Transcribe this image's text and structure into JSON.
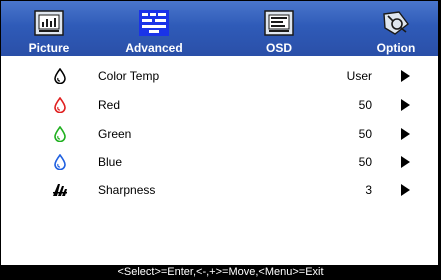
{
  "tabs": [
    {
      "label": "Picture",
      "icon": "picture-icon",
      "active": false
    },
    {
      "label": "Advanced",
      "icon": "advanced-icon",
      "active": true
    },
    {
      "label": "OSD",
      "icon": "osd-icon",
      "active": false
    },
    {
      "label": "Option",
      "icon": "option-icon",
      "active": false
    }
  ],
  "items": [
    {
      "label": "Color Temp",
      "value": "User",
      "icon": "color-temp-icon",
      "icon_color": "#000000"
    },
    {
      "label": "Red",
      "value": "50",
      "icon": "red-drop-icon",
      "icon_color": "#e02020"
    },
    {
      "label": "Green",
      "value": "50",
      "icon": "green-drop-icon",
      "icon_color": "#20b020"
    },
    {
      "label": "Blue",
      "value": "50",
      "icon": "blue-drop-icon",
      "icon_color": "#2060e0"
    },
    {
      "label": "Sharpness",
      "value": "3",
      "icon": "sharpness-icon",
      "icon_color": "#000000"
    }
  ],
  "hint": "<Select>=Enter,<-,+>=Move,<Menu>=Exit",
  "colors": {
    "tabbar": "#2f5bb8",
    "active_tab": "#1a33e8",
    "background": "#ffffff"
  }
}
